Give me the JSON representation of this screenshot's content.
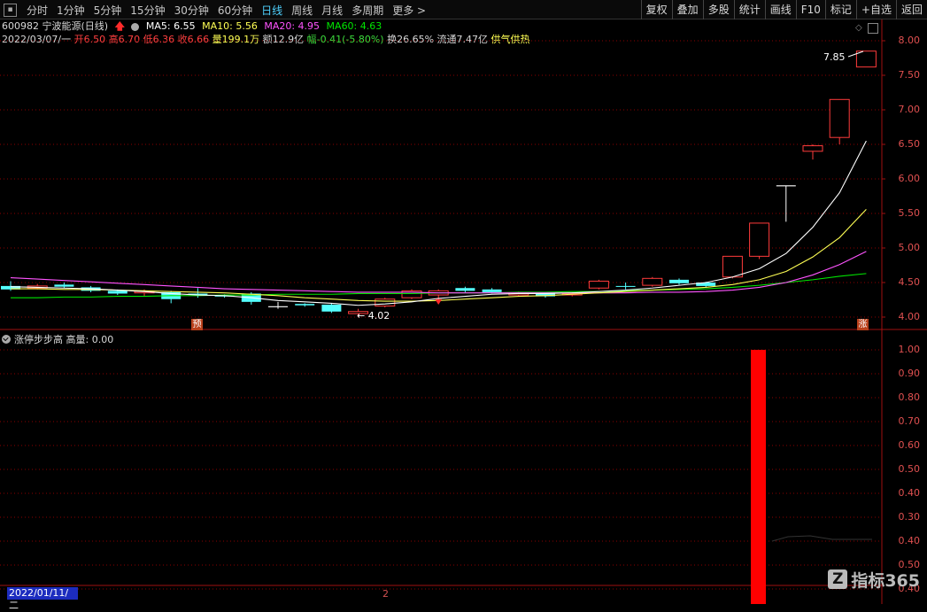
{
  "toolbar": {
    "periods": [
      "分时",
      "1分钟",
      "5分钟",
      "15分钟",
      "30分钟",
      "60分钟",
      "日线",
      "周线",
      "月线",
      "多周期",
      "更多 >"
    ],
    "active_period": "日线",
    "right_buttons": [
      "复权",
      "叠加",
      "多股",
      "统计",
      "画线",
      "F10",
      "标记",
      "+自选",
      "返回"
    ]
  },
  "stock": {
    "code_name": "600982 宁波能源(日线)",
    "ma5": "MA5: 6.55",
    "ma10": "MA10: 5.56",
    "ma20": "MA20: 4.95",
    "ma60": "MA60: 4.63"
  },
  "quote": {
    "date": "2022/03/07/一",
    "open": "开6.50",
    "high": "高6.70",
    "low": "低6.36",
    "close": "收6.66",
    "volume": "量199.1万",
    "amount": "额12.9亿",
    "change": "幅-0.41(-5.80%)",
    "turnover": "换26.65%",
    "float_cap": "流通7.47亿",
    "tag": "供气供热"
  },
  "price_axis": [
    "8.00",
    "7.50",
    "7.00",
    "6.50",
    "6.00",
    "5.50",
    "5.00",
    "4.50",
    "4.00"
  ],
  "annotations": {
    "high_label": "7.85",
    "low_label": "4.02",
    "marker_left": "预",
    "marker_right": "涨"
  },
  "indicator": {
    "title": "涨停步步高 高量: 0.00",
    "axis": [
      "1.00",
      "0.90",
      "0.80",
      "0.70",
      "0.60",
      "0.50",
      "0.40",
      "0.30",
      "0.40",
      "0.50",
      "0.40"
    ]
  },
  "bottom": {
    "date": "2022/01/11/二",
    "marker": "2",
    "logo_text": "指标365"
  },
  "colors": {
    "up": "#ff3b3b",
    "down": "#54ffff",
    "ma5": "#ffffff",
    "ma10": "#ffff54",
    "ma20": "#ff54ff",
    "ma60": "#00e600",
    "grid": "#8b0000"
  },
  "chart_data": {
    "type": "candlestick",
    "price_range": [
      3.85,
      8.15
    ],
    "candles": [
      {
        "o": 4.45,
        "c": 4.4,
        "h": 4.52,
        "l": 4.38
      },
      {
        "o": 4.42,
        "c": 4.45,
        "h": 4.48,
        "l": 4.4
      },
      {
        "o": 4.47,
        "c": 4.44,
        "h": 4.5,
        "l": 4.42
      },
      {
        "o": 4.43,
        "c": 4.38,
        "h": 4.45,
        "l": 4.36
      },
      {
        "o": 4.38,
        "c": 4.34,
        "h": 4.4,
        "l": 4.32
      },
      {
        "o": 4.35,
        "c": 4.37,
        "h": 4.4,
        "l": 4.3
      },
      {
        "o": 4.36,
        "c": 4.26,
        "h": 4.38,
        "l": 4.2
      },
      {
        "o": 4.34,
        "c": 4.32,
        "h": 4.42,
        "l": 4.28
      },
      {
        "o": 4.31,
        "c": 4.3,
        "h": 4.33,
        "l": 4.28
      },
      {
        "o": 4.34,
        "c": 4.22,
        "h": 4.36,
        "l": 4.18
      },
      {
        "o": 4.15,
        "c": 4.15,
        "h": 4.22,
        "l": 4.12
      },
      {
        "o": 4.19,
        "c": 4.17,
        "h": 4.2,
        "l": 4.15
      },
      {
        "o": 4.18,
        "c": 4.08,
        "h": 4.2,
        "l": 4.06
      },
      {
        "o": 4.05,
        "c": 4.08,
        "h": 4.12,
        "l": 4.02
      },
      {
        "o": 4.16,
        "c": 4.26,
        "h": 4.28,
        "l": 4.14
      },
      {
        "o": 4.28,
        "c": 4.38,
        "h": 4.4,
        "l": 4.26
      },
      {
        "o": 4.32,
        "c": 4.38,
        "h": 4.4,
        "l": 4.2
      },
      {
        "o": 4.42,
        "c": 4.38,
        "h": 4.44,
        "l": 4.36
      },
      {
        "o": 4.4,
        "c": 4.36,
        "h": 4.42,
        "l": 4.34
      },
      {
        "o": 4.32,
        "c": 4.35,
        "h": 4.37,
        "l": 4.3
      },
      {
        "o": 4.34,
        "c": 4.3,
        "h": 4.36,
        "l": 4.28
      },
      {
        "o": 4.32,
        "c": 4.34,
        "h": 4.36,
        "l": 4.3
      },
      {
        "o": 4.42,
        "c": 4.52,
        "h": 4.54,
        "l": 4.4
      },
      {
        "o": 4.45,
        "c": 4.44,
        "h": 4.5,
        "l": 4.4
      },
      {
        "o": 4.46,
        "c": 4.56,
        "h": 4.58,
        "l": 4.44
      },
      {
        "o": 4.54,
        "c": 4.49,
        "h": 4.56,
        "l": 4.47
      },
      {
        "o": 4.5,
        "c": 4.45,
        "h": 4.51,
        "l": 4.43
      },
      {
        "o": 4.58,
        "c": 4.88,
        "h": 4.88,
        "l": 4.56
      },
      {
        "o": 4.88,
        "c": 5.36,
        "h": 5.36,
        "l": 4.84
      },
      {
        "o": 5.9,
        "c": 5.9,
        "h": 5.9,
        "l": 5.38
      },
      {
        "o": 6.4,
        "c": 6.48,
        "h": 6.5,
        "l": 6.28
      },
      {
        "o": 6.6,
        "c": 7.15,
        "h": 7.15,
        "l": 6.5
      },
      {
        "o": 7.62,
        "c": 7.85,
        "h": 7.85,
        "l": 7.62
      }
    ],
    "ma5": [
      4.44,
      4.43,
      4.42,
      4.41,
      4.39,
      4.37,
      4.34,
      4.32,
      4.31,
      4.28,
      4.24,
      4.22,
      4.2,
      4.17,
      4.19,
      4.22,
      4.27,
      4.3,
      4.33,
      4.34,
      4.34,
      4.35,
      4.37,
      4.39,
      4.42,
      4.46,
      4.5,
      4.58,
      4.7,
      4.92,
      5.3,
      5.8,
      6.55
    ],
    "ma10": [
      4.41,
      4.41,
      4.4,
      4.4,
      4.39,
      4.38,
      4.37,
      4.36,
      4.35,
      4.33,
      4.31,
      4.28,
      4.26,
      4.24,
      4.23,
      4.23,
      4.24,
      4.26,
      4.28,
      4.3,
      4.31,
      4.33,
      4.35,
      4.37,
      4.39,
      4.41,
      4.43,
      4.47,
      4.54,
      4.66,
      4.87,
      5.15,
      5.56
    ],
    "ma20": [
      4.57,
      4.55,
      4.53,
      4.51,
      4.49,
      4.47,
      4.45,
      4.43,
      4.41,
      4.4,
      4.39,
      4.38,
      4.37,
      4.36,
      4.36,
      4.36,
      4.35,
      4.35,
      4.35,
      4.35,
      4.35,
      4.35,
      4.35,
      4.35,
      4.36,
      4.36,
      4.37,
      4.39,
      4.43,
      4.5,
      4.61,
      4.76,
      4.95
    ],
    "ma60": [
      4.28,
      4.28,
      4.29,
      4.29,
      4.3,
      4.3,
      4.31,
      4.31,
      4.32,
      4.32,
      4.33,
      4.33,
      4.33,
      4.34,
      4.34,
      4.34,
      4.35,
      4.35,
      4.35,
      4.36,
      4.36,
      4.37,
      4.37,
      4.38,
      4.39,
      4.4,
      4.41,
      4.43,
      4.46,
      4.5,
      4.54,
      4.59,
      4.63
    ],
    "indicator_value": 1.0,
    "indicator_index": 28
  }
}
